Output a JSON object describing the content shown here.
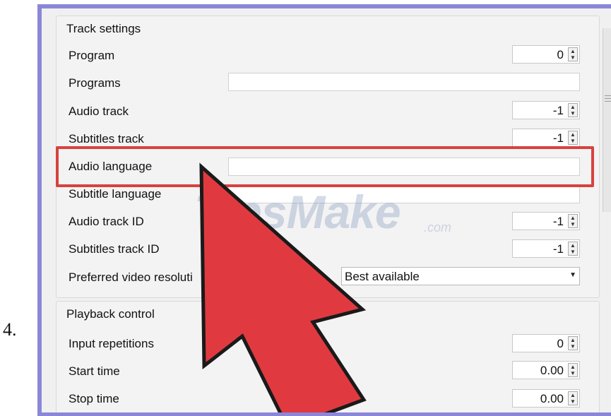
{
  "step_number": "4.",
  "track_settings": {
    "title": "Track settings",
    "program_label": "Program",
    "program_value": "0",
    "programs_label": "Programs",
    "audio_track_label": "Audio track",
    "audio_track_value": "-1",
    "subtitles_track_label": "Subtitles track",
    "subtitles_track_value": "-1",
    "audio_language_label": "Audio language",
    "subtitle_language_label": "Subtitle language",
    "audio_track_id_label": "Audio track ID",
    "audio_track_id_value": "-1",
    "subtitles_track_id_label": "Subtitles track ID",
    "subtitles_track_id_value": "-1",
    "preferred_video_resolution_label": "Preferred video resoluti",
    "preferred_video_resolution_value": "Best available"
  },
  "playback_control": {
    "title": "Playback control",
    "input_repetitions_label": "Input repetitions",
    "input_repetitions_value": "0",
    "start_time_label": "Start time",
    "start_time_value": "0.00",
    "stop_time_label": "Stop time",
    "stop_time_value": "0.00"
  },
  "watermark": {
    "text": "TipsMake",
    "sub": ".com"
  },
  "colors": {
    "highlight": "#d8423e",
    "arrow": "#e03a40",
    "frame": "#8b87d8"
  }
}
